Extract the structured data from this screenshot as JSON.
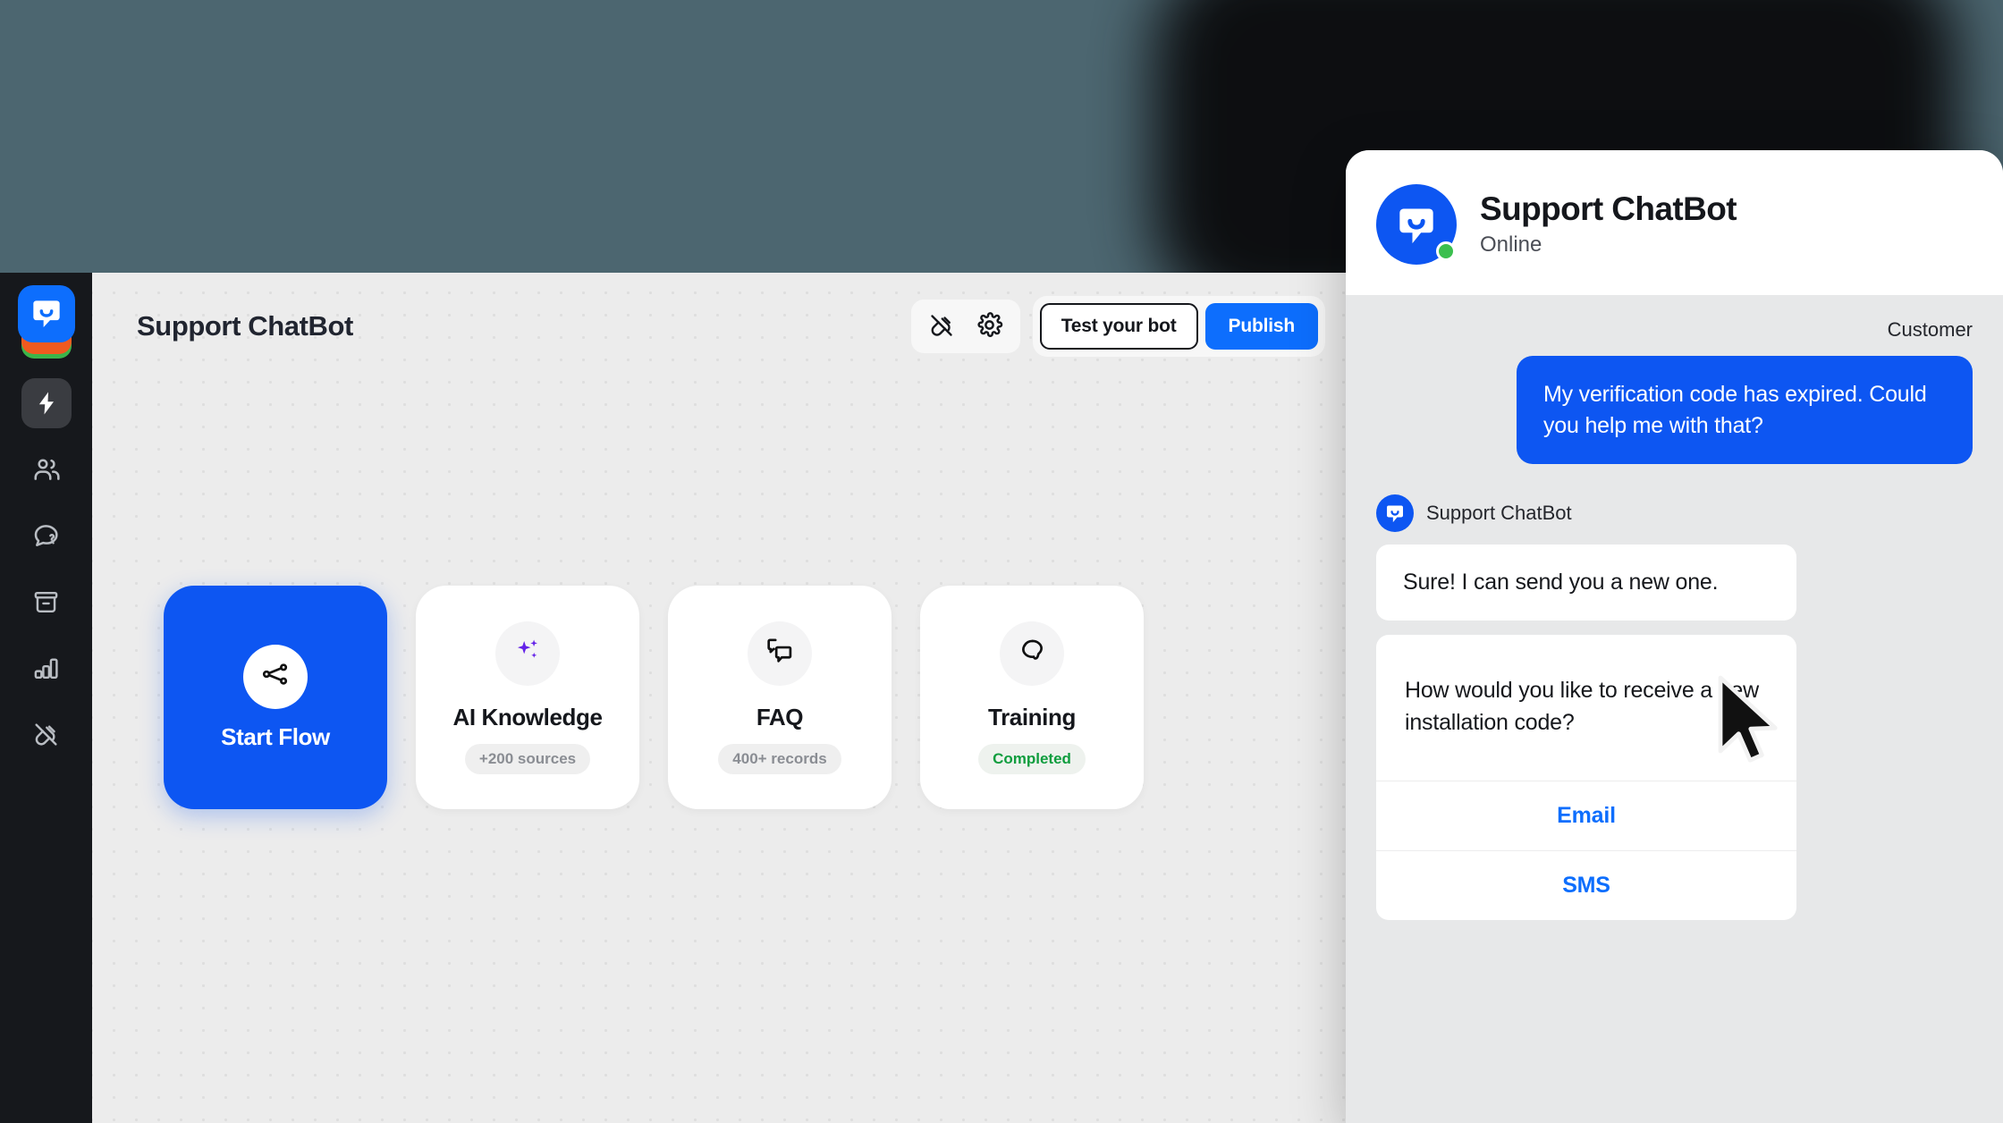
{
  "theme": {
    "background": "#4c6670",
    "accent_blue": "#0d56f2",
    "link_blue": "#0d6efd",
    "rail_bg": "#16181c",
    "canvas_bg": "#ececec",
    "chat_bg": "#e7e8e9",
    "status_green": "#3bbf4e",
    "badge_green": "#0f9d3e"
  },
  "sidebar": {
    "logo_name": "chatbot-logo",
    "items": [
      {
        "icon": "lightning-icon",
        "label": "Automations",
        "active": true
      },
      {
        "icon": "users-icon",
        "label": "Users",
        "active": false
      },
      {
        "icon": "chat-question-icon",
        "label": "Support",
        "active": false
      },
      {
        "icon": "archive-icon",
        "label": "Archives",
        "active": false
      },
      {
        "icon": "bar-chart-icon",
        "label": "Analytics",
        "active": false
      },
      {
        "icon": "plug-off-icon",
        "label": "Integrations",
        "active": false
      }
    ]
  },
  "topbar": {
    "title": "Support ChatBot",
    "icons": [
      {
        "name": "plug-off-icon",
        "label": "Integrations"
      },
      {
        "name": "gear-icon",
        "label": "Settings"
      }
    ],
    "test_label": "Test your bot",
    "publish_label": "Publish"
  },
  "cards": [
    {
      "id": "start-flow",
      "icon": "flow-nodes-icon",
      "label": "Start Flow",
      "badge": null,
      "primary": true
    },
    {
      "id": "ai-knowledge",
      "icon": "sparkles-icon",
      "label": "AI Knowledge",
      "badge": "+200 sources",
      "badge_style": "gray",
      "primary": false
    },
    {
      "id": "faq",
      "icon": "chat-copy-icon",
      "label": "FAQ",
      "badge": "400+ records",
      "badge_style": "gray",
      "primary": false
    },
    {
      "id": "training",
      "icon": "brain-icon",
      "label": "Training",
      "badge": "Completed",
      "badge_style": "green",
      "primary": false
    }
  ],
  "chat": {
    "title": "Support ChatBot",
    "status": "Online",
    "avatar_icon": "chatbot-logo",
    "customer_label": "Customer",
    "customer_message": "My verification code has expired. Could you help me with that?",
    "bot_name": "Support ChatBot",
    "bot_message": "Sure! I can send you a new one.",
    "quick_reply": {
      "question": "How would you like to receive a new installation code?",
      "options": [
        {
          "label": "Email"
        },
        {
          "label": "SMS"
        }
      ]
    }
  },
  "cursor": {
    "name": "mouse-pointer"
  }
}
